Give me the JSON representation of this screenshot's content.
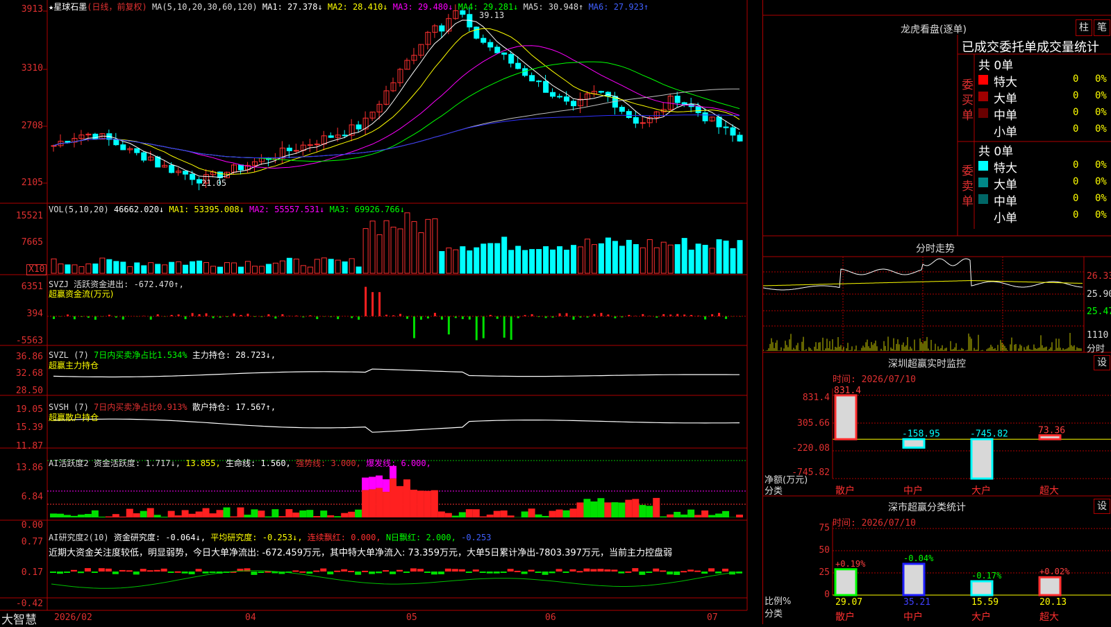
{
  "main": {
    "title": "星球石墨",
    "mode": "(日线，前复权)",
    "ma_params": "MA(5,10,20,30,60,120)",
    "ma": [
      {
        "label": "MA1: 27.378↓",
        "color": "#ffffff"
      },
      {
        "label": "MA2: 28.410↓",
        "color": "#ffff00"
      },
      {
        "label": "MA3: 29.480↓",
        "color": "#ff00ff"
      },
      {
        "label": "MA4: 29.281↓",
        "color": "#00ff00"
      },
      {
        "label": "MA5: 30.948↑",
        "color": "#c0c0c0"
      },
      {
        "label": "MA6: 27.923↑",
        "color": "#0000ff"
      }
    ],
    "y_labels": [
      "3913",
      "3310",
      "2708",
      "2105"
    ],
    "high_label": "39.13",
    "low_label": "21.05"
  },
  "vol": {
    "label": "VOL(5,10,20)",
    "value": "46662.020↓",
    "ma1": "MA1: 53395.008↓",
    "ma2": "MA2: 55557.531↓",
    "ma3": "MA3: 69926.766↓",
    "y_labels": [
      "15521",
      "7665"
    ],
    "unit": "X10"
  },
  "svzj": {
    "label": "SVZJ  活跃资金进出: -672.470↑,",
    "sub": "超赢资金流(万元)",
    "y_labels": [
      "6351",
      "394",
      "-5563"
    ]
  },
  "svzl": {
    "label": "SVZL (7)",
    "ratio": "7日内买卖净占比1.534%",
    "hold": "主力持仓: 28.723↓,",
    "sub": "超赢主力持仓",
    "y_labels": [
      "36.86",
      "32.68",
      "28.50"
    ]
  },
  "svsh": {
    "label": "SVSH (7)",
    "ratio": "7日内买卖净占比0.913%",
    "hold": "散户持仓: 17.567↑,",
    "sub": "超赢散户持仓",
    "y_labels": [
      "19.05",
      "15.39",
      "11.87"
    ]
  },
  "ai2": {
    "label": "AI活跃度2 资金活跃度: 1.717↓,",
    "v2": "13.855,",
    "life": "生命线: 1.560,",
    "strong": "强势线: 3.000,",
    "burst": "爆发线: 6.000,",
    "y_labels": [
      "13.86",
      "6.84",
      "0.00"
    ]
  },
  "ai_research": {
    "label": "AI研究度2(10)",
    "v1": "资金研究度: -0.064↓,",
    "v2": "平均研究度: -0.253↓,",
    "v3": "连续飘红: 0.000,",
    "v4": "N日飘红: 2.000,",
    "v5": "-0.253",
    "summary": "近期大资金关注度较低，明显弱势，今日大单净流出: -672.459万元，其中特大单净流入: 73.359万元，大单5日累计净出-7803.397万元，当前主力控盘弱",
    "y_labels": [
      "0.77",
      "0.17",
      "-0.42"
    ]
  },
  "bottom": {
    "brand": "大智慧",
    "dates": [
      "2026/02",
      "04",
      "05",
      "06",
      "07"
    ]
  },
  "right": {
    "dragon_title": "龙虎看盘(逐单)",
    "btn_bar": "柱",
    "btn_stroke": "笔",
    "stats_title": "已成交委托单成交量统计",
    "buy_side": "委买单",
    "sell_side": "委卖单",
    "buy_total": "共 0单",
    "sell_total": "共 0单",
    "buy_rows": [
      {
        "label": "特大",
        "val": "0",
        "pct": "0%",
        "color": "#ff0000"
      },
      {
        "label": "大单",
        "val": "0",
        "pct": "0%",
        "color": "#a00000"
      },
      {
        "label": "中单",
        "val": "0",
        "pct": "0%",
        "color": "#6a0000"
      },
      {
        "label": "小单",
        "val": "0",
        "pct": "0%",
        "color": "#000000"
      }
    ],
    "sell_rows": [
      {
        "label": "特大",
        "val": "0",
        "pct": "0%",
        "color": "#00ffff"
      },
      {
        "label": "大单",
        "val": "0",
        "pct": "0%",
        "color": "#008888"
      },
      {
        "label": "中单",
        "val": "0",
        "pct": "0%",
        "color": "#006666"
      },
      {
        "label": "小单",
        "val": "0",
        "pct": "0%",
        "color": "#000000"
      }
    ],
    "intraday_title": "分时走势",
    "intraday_y": [
      "26.33",
      "25.90",
      "25.47"
    ],
    "intraday_vol": "1110",
    "intraday_tag": "分时",
    "sz_monitor_title": "深圳超赢实时监控",
    "sz_set": "设",
    "time1": "时间: 2026/07/10",
    "monitor_y": [
      "831.4",
      "305.66",
      "-220.08",
      "-745.82"
    ],
    "monitor_unit": "净额(万元)",
    "monitor_cat": "分类",
    "classify_title": "深市超赢分类统计",
    "classify_set": "设",
    "time2": "时间: 2026/07/10",
    "classify_y": [
      "75",
      "50",
      "25",
      "0"
    ],
    "classify_unit": "比例%",
    "classify_cat": "分类"
  },
  "chart_data": [
    {
      "type": "bar",
      "title": "深圳超赢实时监控",
      "categories": [
        "散户",
        "中户",
        "大户",
        "超大"
      ],
      "values": [
        831.4,
        -158.95,
        -745.82,
        73.36
      ],
      "value_labels": [
        "831.4",
        "-158.95",
        "-745.82",
        "73.36"
      ],
      "ylabel": "净额(万元)",
      "ylim": [
        -745.82,
        831.4
      ]
    },
    {
      "type": "bar",
      "title": "深市超赢分类统计",
      "categories": [
        "散户",
        "中户",
        "大户",
        "超大"
      ],
      "values": [
        29.07,
        35.21,
        15.59,
        20.13
      ],
      "changes": [
        "+0.19%",
        "-0.04%",
        "-0.17%",
        "+0.02%"
      ],
      "ylabel": "比例%",
      "ylim": [
        0,
        75
      ]
    }
  ]
}
